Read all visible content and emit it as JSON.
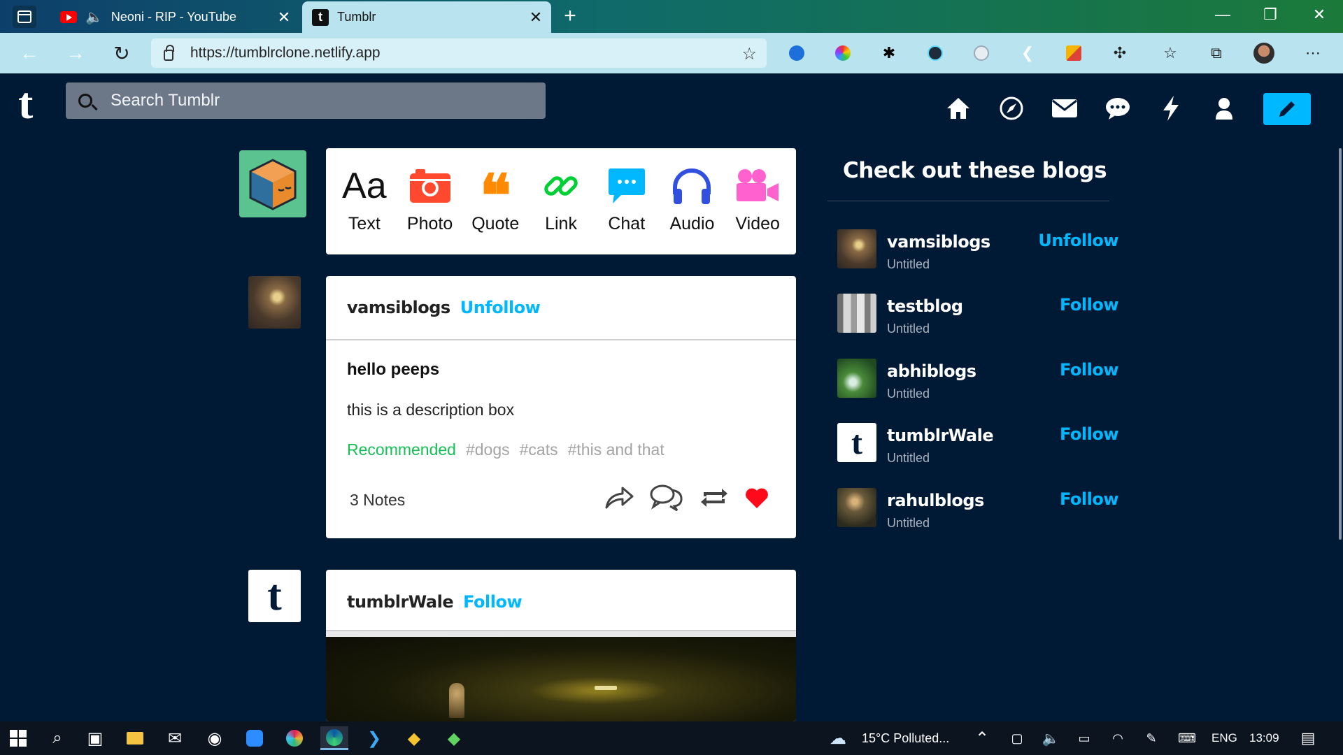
{
  "browser": {
    "tabs": [
      {
        "title": "Neoni - RIP - YouTube"
      },
      {
        "title": "Tumblr",
        "favicon": "t"
      }
    ],
    "url": "https://tumblrclone.netlify.app"
  },
  "header": {
    "logo": "t",
    "search_placeholder": "Search Tumblr",
    "accent": "#00b8ff"
  },
  "composer": {
    "types": [
      {
        "label": "Text",
        "icon": "text-icon"
      },
      {
        "label": "Photo",
        "icon": "camera-icon"
      },
      {
        "label": "Quote",
        "icon": "quote-icon"
      },
      {
        "label": "Link",
        "icon": "link-icon"
      },
      {
        "label": "Chat",
        "icon": "chat-icon"
      },
      {
        "label": "Audio",
        "icon": "headphones-icon"
      },
      {
        "label": "Video",
        "icon": "video-camera-icon"
      }
    ]
  },
  "posts": [
    {
      "user": "vamsiblogs",
      "follow_label": "Unfollow",
      "title": "hello peeps",
      "description": "this is a description box",
      "tags": [
        "Recommended",
        "#dogs",
        "#cats",
        "#this and that"
      ],
      "notes": "3 Notes"
    },
    {
      "user": "tumblrWale",
      "follow_label": "Follow"
    }
  ],
  "rail": {
    "title": "Check out these blogs",
    "blogs": [
      {
        "name": "vamsiblogs",
        "subtitle": "Untitled",
        "action": "Unfollow"
      },
      {
        "name": "testblog",
        "subtitle": "Untitled",
        "action": "Follow"
      },
      {
        "name": "abhiblogs",
        "subtitle": "Untitled",
        "action": "Follow"
      },
      {
        "name": "tumblrWale",
        "subtitle": "Untitled",
        "action": "Follow"
      },
      {
        "name": "rahulblogs",
        "subtitle": "Untitled",
        "action": "Follow"
      }
    ]
  },
  "taskbar": {
    "weather": "15°C  Polluted...",
    "language": "ENG",
    "time": "13:09"
  }
}
